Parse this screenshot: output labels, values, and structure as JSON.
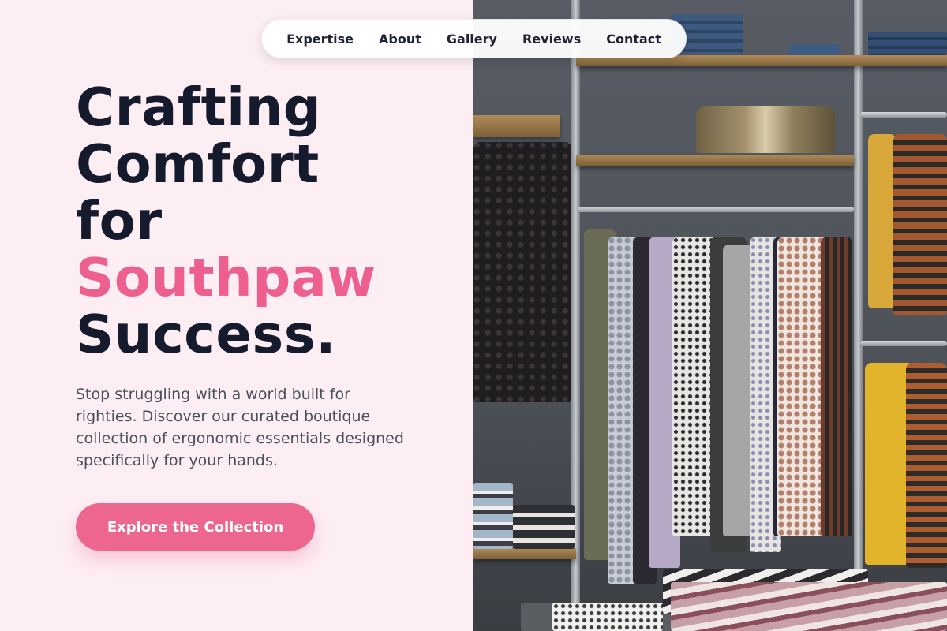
{
  "nav": {
    "items": [
      {
        "label": "Expertise"
      },
      {
        "label": "About"
      },
      {
        "label": "Gallery"
      },
      {
        "label": "Reviews"
      },
      {
        "label": "Contact"
      }
    ]
  },
  "hero": {
    "title_lines": [
      "Crafting",
      "Comfort",
      "for",
      "Southpaw",
      "Success."
    ],
    "subtitle": "Stop struggling with a world built for righties. Discover our curated boutique collection of ergonomic essentials designed specifically for your hands.",
    "cta_label": "Explore the Collection"
  },
  "colors": {
    "background": "#fdeef3",
    "heading": "#151a2c",
    "accent": "#ec5f8e",
    "button": "#ec6690",
    "body_text": "#4a4f5c"
  },
  "image": {
    "subject": "boutique clothing rack with dresses, shirts, folded garments and a bag on wooden shelves"
  }
}
